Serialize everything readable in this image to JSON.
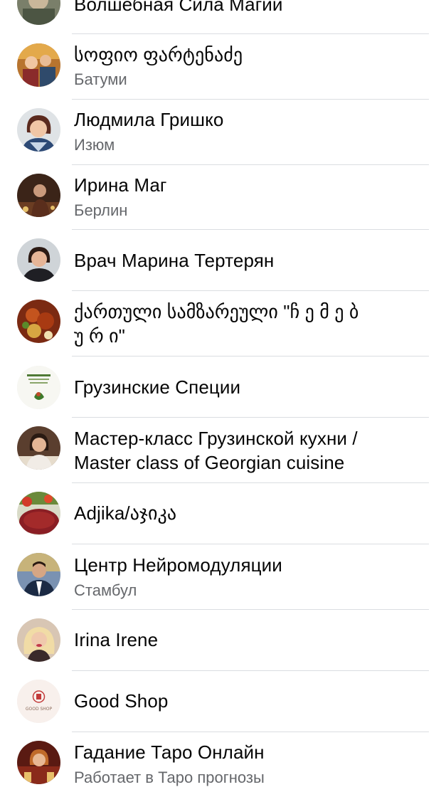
{
  "items": [
    {
      "name": "Волшебная Сила Магии",
      "subtitle": "",
      "avatar": "page-avatar"
    },
    {
      "name": "სოფიო ფარტენაძე",
      "subtitle": "Батуми",
      "avatar": "profile-avatar"
    },
    {
      "name": "Людмила Гришко",
      "subtitle": "Изюм",
      "avatar": "profile-avatar"
    },
    {
      "name": "Ирина Маг",
      "subtitle": "Берлин",
      "avatar": "profile-avatar"
    },
    {
      "name": "Врач Марина Тертерян",
      "subtitle": "",
      "avatar": "profile-avatar"
    },
    {
      "name_lines": [
        "ქართული სამზარეული \"ჩ ე მ ე ბ",
        "უ რ ი\""
      ],
      "subtitle": "",
      "avatar": "food-avatar"
    },
    {
      "name": "Грузинские Специи",
      "subtitle": "",
      "avatar": "logo-avatar"
    },
    {
      "name_lines": [
        "Мастер-класс Грузинской кухни /",
        "Master class of Georgian cuisine"
      ],
      "subtitle": "",
      "avatar": "profile-avatar"
    },
    {
      "name": "Adjika/აჯიკა",
      "subtitle": "",
      "avatar": "food-avatar"
    },
    {
      "name": "Центр Нейромодуляции",
      "subtitle": "Стамбул",
      "avatar": "profile-avatar"
    },
    {
      "name": "Irina Irene",
      "subtitle": "",
      "avatar": "profile-avatar"
    },
    {
      "name": "Good Shop",
      "subtitle": "",
      "avatar": "logo-avatar",
      "logo_text": "GOOD SHOP"
    },
    {
      "name": "Гадание Таро Онлайн",
      "subtitle": "Работает в Таро прогнозы",
      "avatar": "profile-avatar"
    }
  ],
  "colors": {
    "text": "#050505",
    "secondary_text": "#65676b",
    "divider": "#dadde1",
    "background": "#ffffff"
  }
}
